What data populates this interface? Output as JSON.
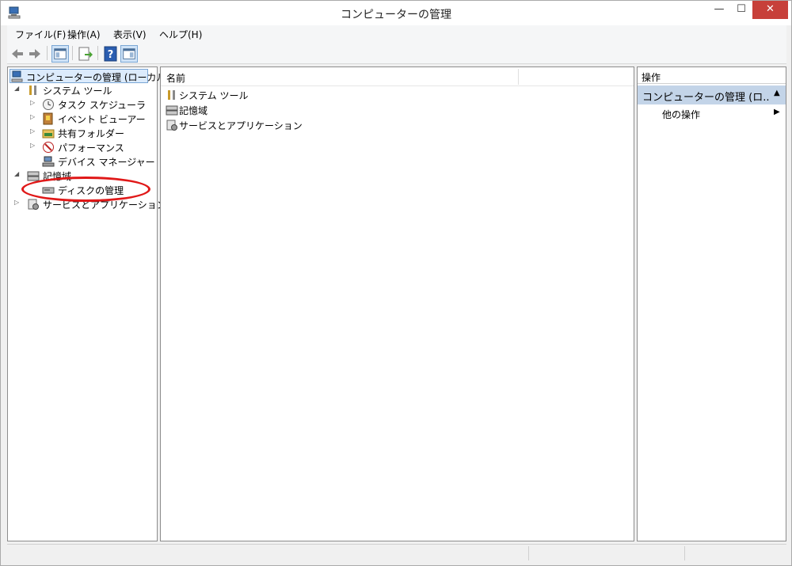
{
  "window": {
    "title": "コンピューターの管理",
    "minimize_glyph": "—",
    "maximize_glyph": "☐",
    "close_glyph": "✕",
    "app_icon": "computer-management-icon"
  },
  "menubar": {
    "items": [
      "ファイル(F)",
      "操作(A)",
      "表示(V)",
      "ヘルプ(H)"
    ]
  },
  "toolbar": {
    "buttons": [
      "back-arrow-icon",
      "forward-arrow-icon",
      "show-hide-console-tree-icon",
      "export-list-icon",
      "help-icon",
      "show-hide-action-pane-icon"
    ]
  },
  "tree": {
    "root": "コンピューターの管理 (ローカル)",
    "system_tools": "システム ツール",
    "task_scheduler": "タスク スケジューラ",
    "event_viewer": "イベント ビューアー",
    "shared_folders": "共有フォルダー",
    "performance": "パフォーマンス",
    "device_manager": "デバイス マネージャー",
    "storage": "記憶域",
    "disk_management": "ディスクの管理",
    "services_apps": "サービスとアプリケーション"
  },
  "list": {
    "column_name": "名前",
    "items": [
      "システム ツール",
      "記憶域",
      "サービスとアプリケーション"
    ]
  },
  "actions": {
    "header": "操作",
    "group_label": "コンピューターの管理 (ロ...",
    "other_actions": "他の操作"
  },
  "colors": {
    "selection": "#dcebfc",
    "action_group_bg": "#c3d4e8",
    "close_button": "#c7403a",
    "annotation_red": "#e01818"
  }
}
